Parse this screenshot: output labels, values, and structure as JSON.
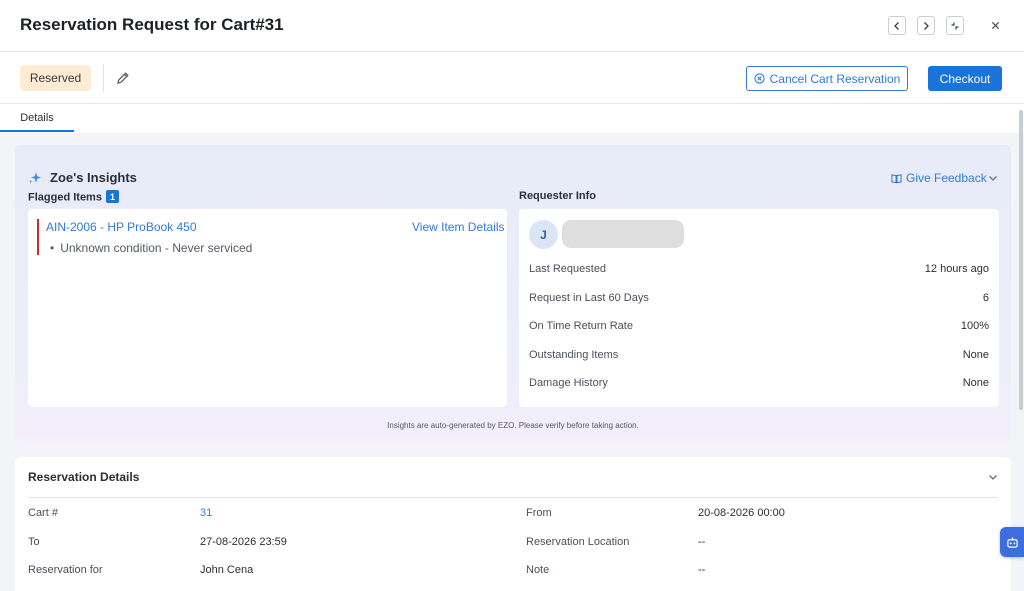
{
  "header": {
    "title": "Reservation Request for Cart#31"
  },
  "toolbar": {
    "status": "Reserved",
    "cancel_label": "Cancel Cart Reservation",
    "checkout_label": "Checkout"
  },
  "tabs": [
    {
      "label": "Details"
    }
  ],
  "insights": {
    "title": "Zoe's Insights",
    "feedback_label": "Give Feedback",
    "flagged": {
      "label": "Flagged Items",
      "count": "1",
      "item": "AIN-2006 - HP ProBook 450",
      "view_label": "View Item Details",
      "note": "Unknown condition - Never serviced"
    },
    "requester": {
      "label": "Requester Info",
      "initial": "J",
      "rows": [
        {
          "label": "Last Requested",
          "value": "12 hours ago"
        },
        {
          "label": "Request in Last 60 Days",
          "value": "6"
        },
        {
          "label": "On Time Return Rate",
          "value": "100%"
        },
        {
          "label": "Outstanding Items",
          "value": "None"
        },
        {
          "label": "Damage History",
          "value": "None"
        }
      ]
    },
    "footer": "Insights are auto-generated by EZO. Please verify before taking action."
  },
  "reservation": {
    "title": "Reservation Details",
    "rows": [
      {
        "label": "Cart #",
        "value": "31"
      },
      {
        "label": "From",
        "value": "20-08-2026 00:00"
      },
      {
        "label": "To",
        "value": "27-08-2026 23:59"
      },
      {
        "label": "Reservation Location",
        "value": "--"
      },
      {
        "label": "Reservation for",
        "value": "John Cena"
      },
      {
        "label": "Note",
        "value": "--"
      }
    ]
  },
  "colors": {
    "accent": "#1a73d8",
    "status_badge_bg": "#fdecd3",
    "flag_bar": "#c62d2d"
  }
}
